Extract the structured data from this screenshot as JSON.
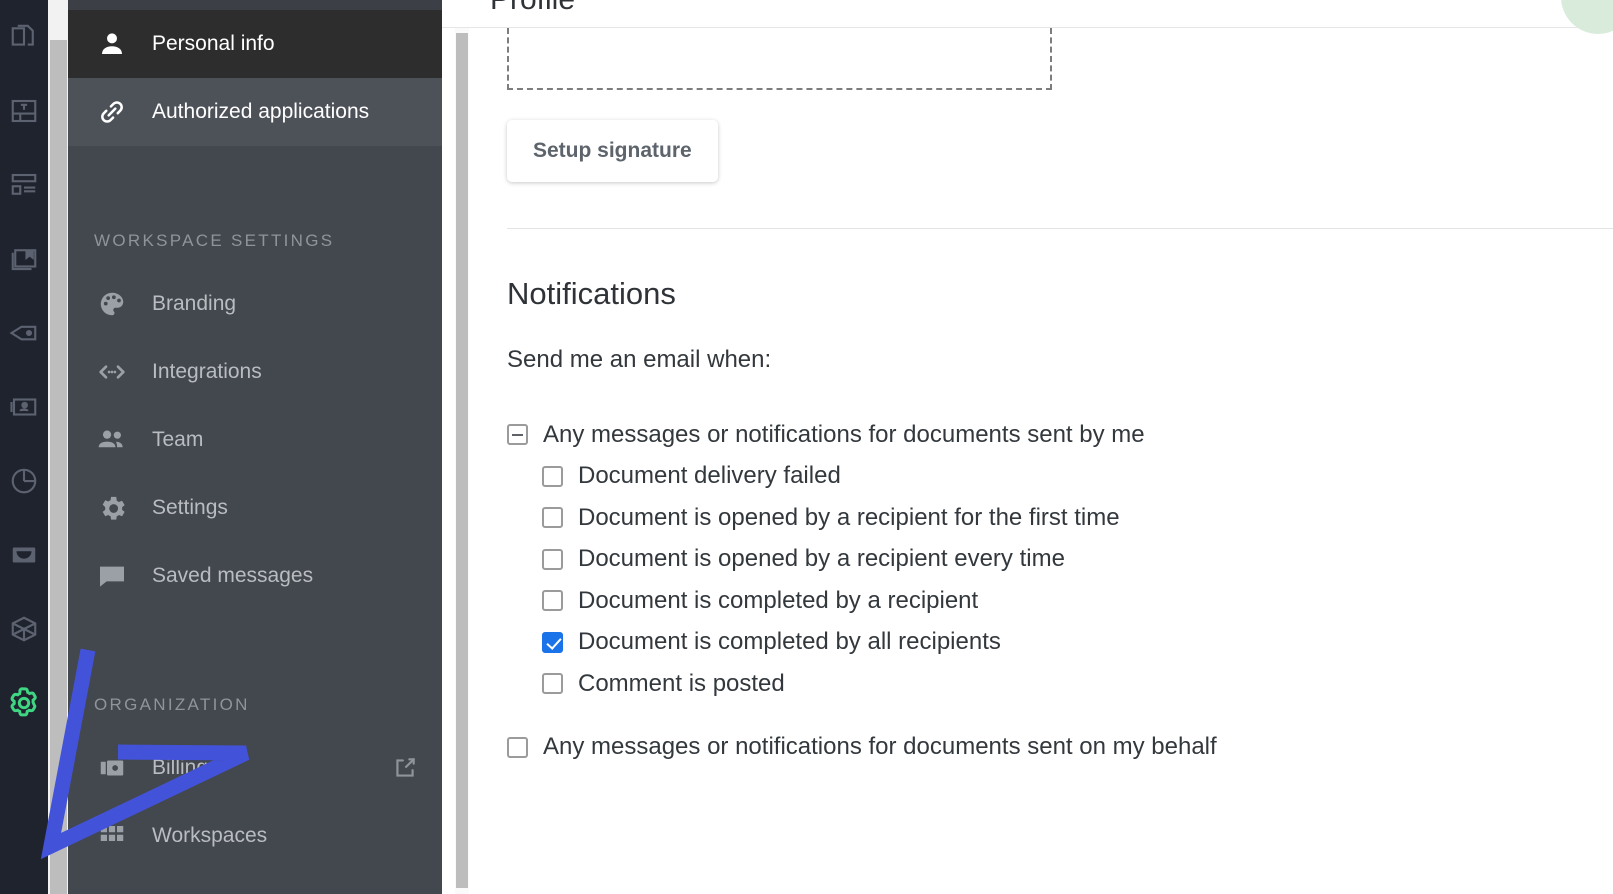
{
  "rail": {
    "items": [
      {
        "name": "documents-icon"
      },
      {
        "name": "template-icon"
      },
      {
        "name": "layout-icon"
      },
      {
        "name": "bookmark-icon"
      },
      {
        "name": "tag-icon"
      },
      {
        "name": "contact-card-icon"
      },
      {
        "name": "pie-chart-icon"
      },
      {
        "name": "inbox-icon"
      },
      {
        "name": "package-icon"
      },
      {
        "name": "settings-gear-icon"
      }
    ],
    "accent_color": "#3fd683"
  },
  "sidebar": {
    "primary": [
      {
        "label": "Personal info",
        "icon": "person-icon",
        "active": true
      },
      {
        "label": "Authorized applications",
        "icon": "link-icon",
        "active": false
      }
    ],
    "workspace_section_label": "WORKSPACE SETTINGS",
    "workspace_items": [
      {
        "label": "Branding",
        "icon": "palette-icon"
      },
      {
        "label": "Integrations",
        "icon": "code-icon"
      },
      {
        "label": "Team",
        "icon": "people-icon"
      },
      {
        "label": "Settings",
        "icon": "gear-icon"
      },
      {
        "label": "Saved messages",
        "icon": "chat-icon"
      }
    ],
    "organization_section_label": "ORGANIZATION",
    "organization_items": [
      {
        "label": "Billing",
        "icon": "billing-icon",
        "external": true
      },
      {
        "label": "Workspaces",
        "icon": "grid-icon",
        "external": false
      }
    ]
  },
  "main": {
    "page_title": "Profile",
    "setup_signature_label": "Setup signature",
    "notifications_title": "Notifications",
    "notifications_subtitle": "Send me an email when:",
    "groups": [
      {
        "label": "Any messages or notifications for documents sent by me",
        "state": "indeterminate",
        "children": [
          {
            "label": "Document delivery failed",
            "checked": false
          },
          {
            "label": "Document is opened by a recipient for the first time",
            "checked": false
          },
          {
            "label": "Document is opened by a recipient every time",
            "checked": false
          },
          {
            "label": "Document is completed by a recipient",
            "checked": false
          },
          {
            "label": "Document is completed by all recipients",
            "checked": true
          },
          {
            "label": "Comment is posted",
            "checked": false
          }
        ]
      },
      {
        "label": "Any messages or notifications for documents sent on my behalf",
        "state": "unchecked",
        "children": []
      }
    ]
  },
  "annotation": {
    "color": "#4353d9",
    "shape": "arrow-pointing-to-settings-gear"
  },
  "colors": {
    "rail_bg": "#1f232e",
    "sidebar_bg": "#43474e",
    "active_item_bg": "#2d2d2d",
    "checkbox_accent": "#1a73e8"
  }
}
